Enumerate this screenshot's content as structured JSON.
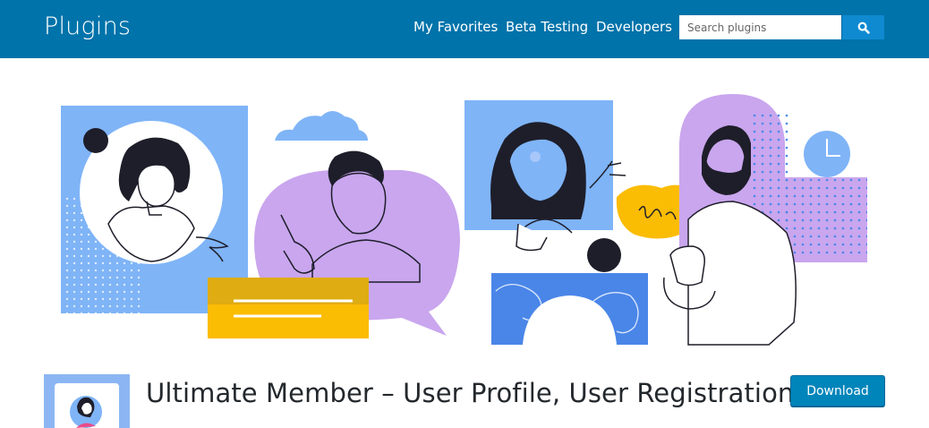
{
  "header": {
    "logo": "Plugins",
    "nav": [
      "My Favorites",
      "Beta Testing",
      "Developers"
    ],
    "search": {
      "placeholder": "Search plugins",
      "button_icon": "search-icon"
    }
  },
  "banner": {
    "icon": "plugin-banner-illustration"
  },
  "plugin": {
    "title": "Ultimate Member – User Profile, User Registration,",
    "download_label": "Download",
    "icon": "plugin-icon"
  },
  "colors": {
    "header_bg": "#0073aa",
    "button_bg": "#0085ba",
    "purple": "#c9a6ee",
    "blue": "#7fb4f7",
    "yellow": "#fbbc04",
    "dark": "#1e1e2a"
  }
}
